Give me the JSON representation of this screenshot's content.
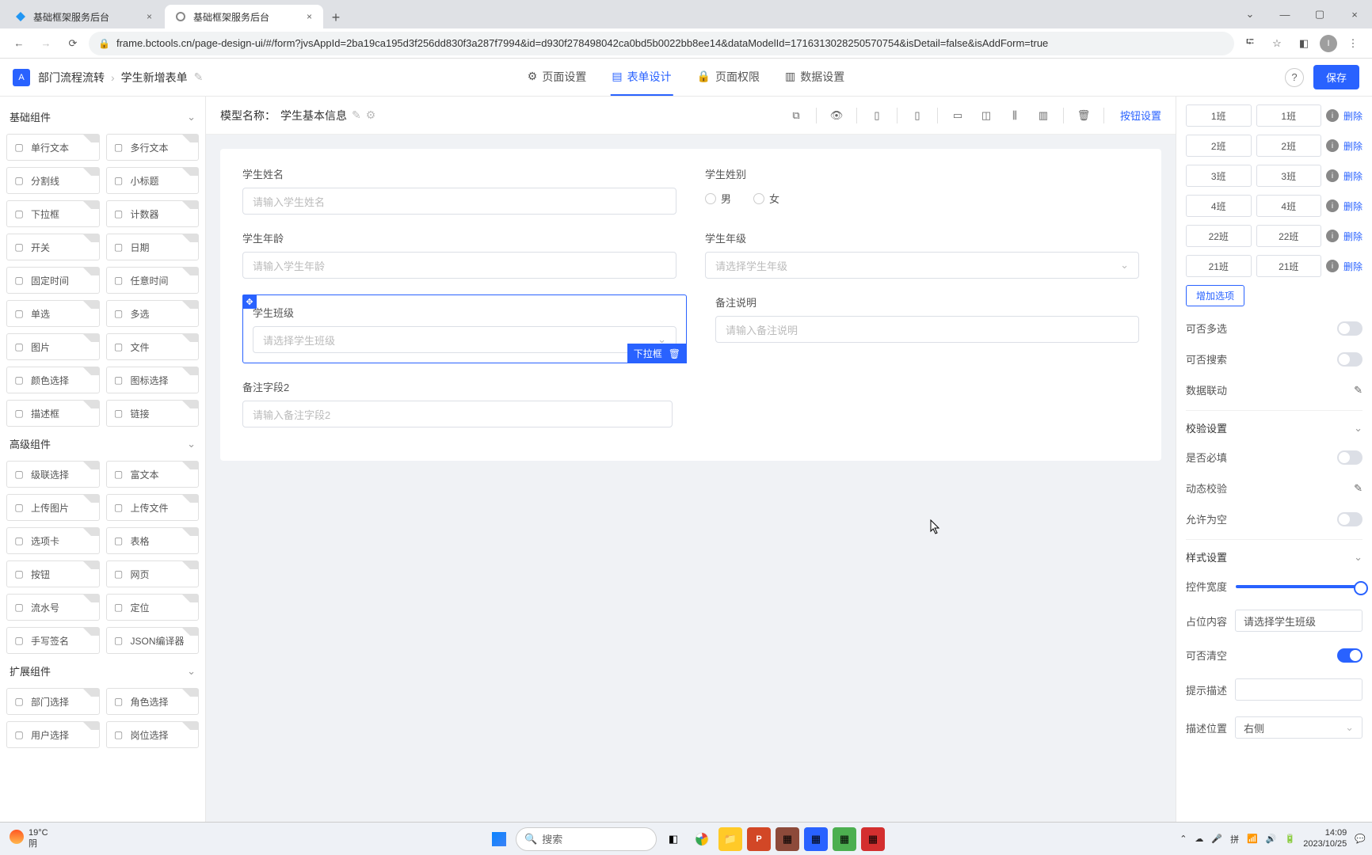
{
  "browser": {
    "tabs": [
      {
        "title": "基础框架服务后台",
        "active": false
      },
      {
        "title": "基础框架服务后台",
        "active": true
      }
    ],
    "url": "frame.bctools.cn/page-design-ui/#/form?jvsAppId=2ba19ca195d3f256dd830f3a287f7994&id=d930f278498042ca0bd5b0022bb8ee14&dataModelId=1716313028250570754&isDetail=false&isAddForm=true"
  },
  "header": {
    "breadcrumb": [
      "部门流程流转",
      "学生新增表单"
    ],
    "tabs": [
      {
        "icon": "gear-icon",
        "label": "页面设置"
      },
      {
        "icon": "form-icon",
        "label": "表单设计",
        "active": true
      },
      {
        "icon": "lock-icon",
        "label": "页面权限"
      },
      {
        "icon": "bars-icon",
        "label": "数据设置"
      }
    ],
    "save": "保存"
  },
  "left": {
    "groups": {
      "basic": {
        "title": "基础组件",
        "items": [
          "单行文本",
          "多行文本",
          "分割线",
          "小标题",
          "下拉框",
          "计数器",
          "开关",
          "日期",
          "固定时间",
          "任意时间",
          "单选",
          "多选",
          "图片",
          "文件",
          "颜色选择",
          "图标选择",
          "描述框",
          "链接"
        ]
      },
      "advanced": {
        "title": "高级组件",
        "items": [
          "级联选择",
          "富文本",
          "上传图片",
          "上传文件",
          "选项卡",
          "表格",
          "按钮",
          "网页",
          "流水号",
          "定位",
          "手写签名",
          "JSON编译器"
        ]
      },
      "extend": {
        "title": "扩展组件",
        "items": [
          "部门选择",
          "角色选择",
          "用户选择",
          "岗位选择"
        ]
      }
    }
  },
  "canvas": {
    "model_prefix": "模型名称：",
    "model_name": "学生基本信息",
    "tb": {
      "btn_settings": "按钮设置"
    },
    "fields": {
      "name": {
        "label": "学生姓名",
        "placeholder": "请输入学生姓名"
      },
      "sex": {
        "label": "学生姓别",
        "opts": [
          "男",
          "女"
        ]
      },
      "age": {
        "label": "学生年龄",
        "placeholder": "请输入学生年龄"
      },
      "grade": {
        "label": "学生年级",
        "placeholder": "请选择学生年级"
      },
      "class": {
        "label": "学生班级",
        "placeholder": "请选择学生班级",
        "tag": "下拉框"
      },
      "remark": {
        "label": "备注说明",
        "placeholder": "请输入备注说明"
      },
      "remark2": {
        "label": "备注字段2",
        "placeholder": "请输入备注字段2"
      }
    }
  },
  "right": {
    "options": [
      {
        "k": "1班",
        "v": "1班"
      },
      {
        "k": "2班",
        "v": "2班"
      },
      {
        "k": "3班",
        "v": "3班"
      },
      {
        "k": "4班",
        "v": "4班"
      },
      {
        "k": "22班",
        "v": "22班"
      },
      {
        "k": "21班",
        "v": "21班"
      }
    ],
    "delete": "删除",
    "add_option": "增加选项",
    "multi_sel": "可否多选",
    "searchable": "可否搜索",
    "data_link": "数据联动",
    "valid_section": "校验设置",
    "required": "是否必填",
    "dyn_valid": "动态校验",
    "allow_empty": "允许为空",
    "style_section": "样式设置",
    "ctrl_width": "控件宽度",
    "placeholder": "占位内容",
    "placeholder_val": "请选择学生班级",
    "clearable": "可否清空",
    "tip_desc": "提示描述",
    "desc_pos": "描述位置",
    "desc_pos_val": "右侧"
  },
  "taskbar": {
    "weather_temp": "19°C",
    "weather_cond": "阴",
    "search": "搜索",
    "time": "14:09",
    "date": "2023/10/25"
  }
}
